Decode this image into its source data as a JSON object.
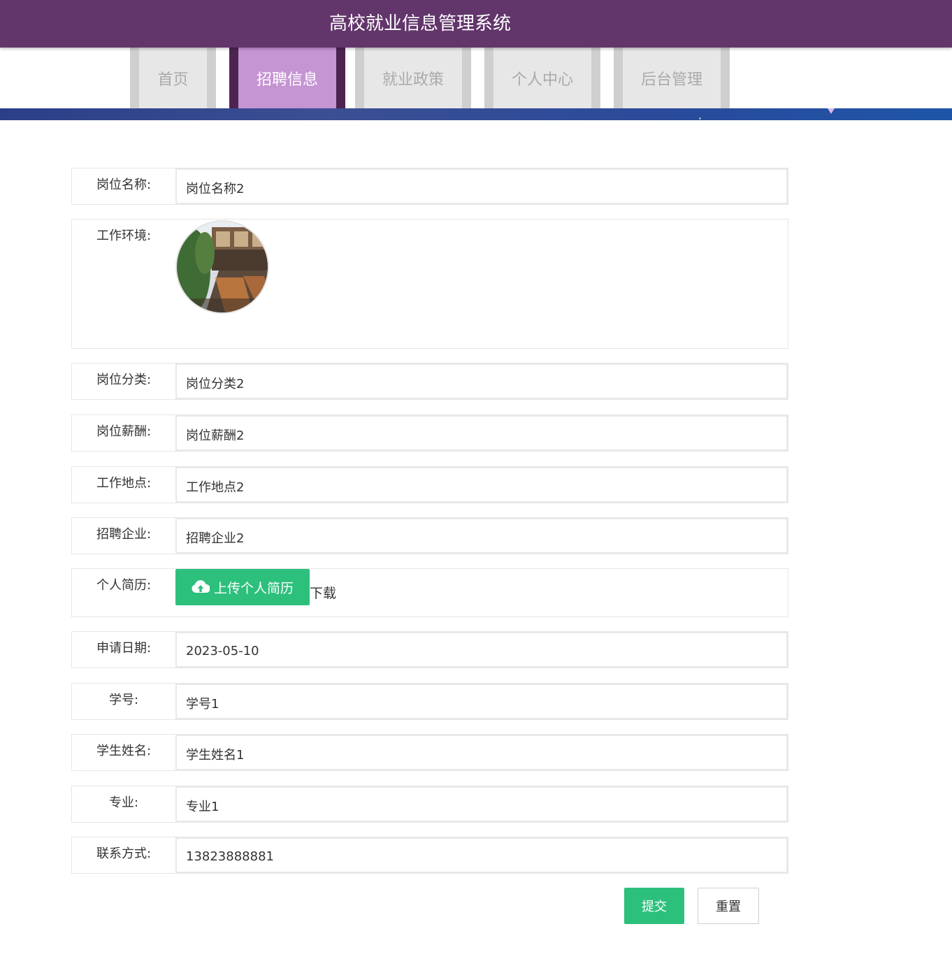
{
  "header": {
    "title": "高校就业信息管理系统"
  },
  "nav": {
    "tabs": [
      {
        "label": "首页",
        "active": false
      },
      {
        "label": "招聘信息",
        "active": true
      },
      {
        "label": "就业政策",
        "active": false
      },
      {
        "label": "个人中心",
        "active": false
      },
      {
        "label": "后台管理",
        "active": false
      }
    ]
  },
  "form": {
    "job_name": {
      "label": "岗位名称:",
      "value": "岗位名称2"
    },
    "work_env": {
      "label": "工作环境:",
      "image": "restaurant-terrace-photo"
    },
    "job_category": {
      "label": "岗位分类:",
      "value": "岗位分类2"
    },
    "job_salary": {
      "label": "岗位薪酬:",
      "value": "岗位薪酬2"
    },
    "work_location": {
      "label": "工作地点:",
      "value": "工作地点2"
    },
    "company": {
      "label": "招聘企业:",
      "value": "招聘企业2"
    },
    "resume": {
      "label": "个人简历:",
      "upload_label": "上传个人简历",
      "download_label": "下载",
      "upload_icon": "cloud-upload-icon"
    },
    "apply_date": {
      "label": "申请日期:",
      "value": "2023-05-10"
    },
    "student_id": {
      "label": "学号:",
      "value": "学号1"
    },
    "student_name": {
      "label": "学生姓名:",
      "value": "学生姓名1"
    },
    "major": {
      "label": "专业:",
      "value": "专业1"
    },
    "contact": {
      "label": "联系方式:",
      "value": "13823888881"
    }
  },
  "actions": {
    "submit_label": "提交",
    "reset_label": "重置"
  },
  "colors": {
    "header": "#62356b",
    "active_tab": "#c594d3",
    "primary_button": "#2dc07d"
  }
}
